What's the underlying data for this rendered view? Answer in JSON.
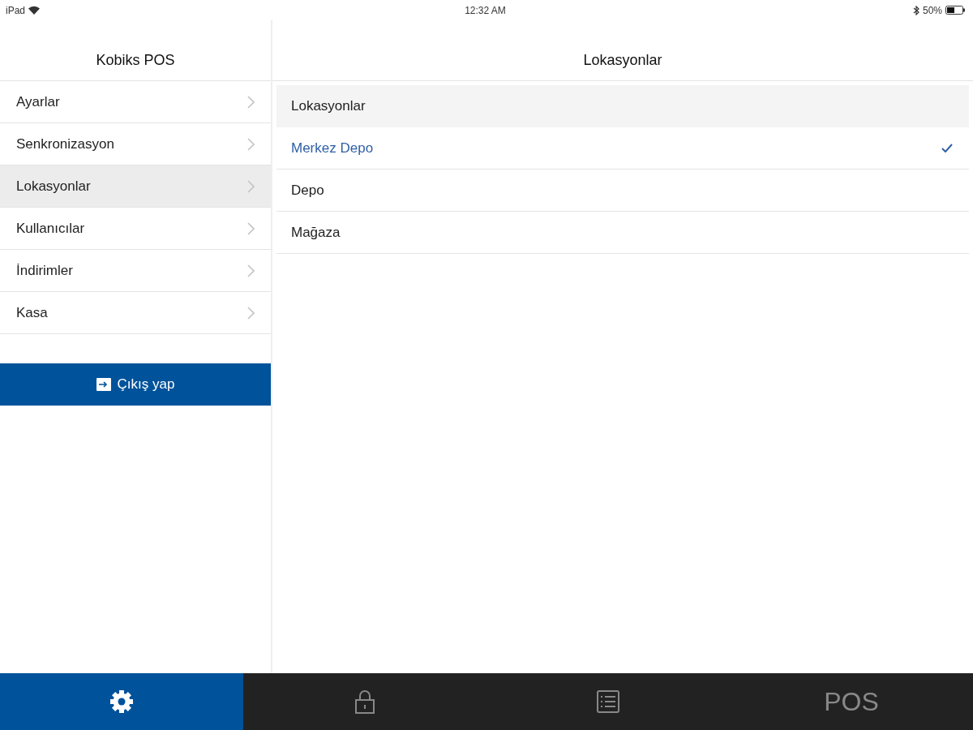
{
  "status_bar": {
    "carrier": "iPad",
    "time": "12:32 AM",
    "battery": "50%"
  },
  "sidebar": {
    "title": "Kobiks POS",
    "items": [
      {
        "label": "Ayarlar",
        "selected": false
      },
      {
        "label": "Senkronizasyon",
        "selected": false
      },
      {
        "label": "Lokasyonlar",
        "selected": true
      },
      {
        "label": "Kullanıcılar",
        "selected": false
      },
      {
        "label": "İndirimler",
        "selected": false
      },
      {
        "label": "Kasa",
        "selected": false
      }
    ],
    "logout_button": "Çıkış yap"
  },
  "detail": {
    "title": "Lokasyonlar",
    "section_header": "Lokasyonlar",
    "items": [
      {
        "label": "Merkez Depo",
        "selected": true
      },
      {
        "label": "Depo",
        "selected": false
      },
      {
        "label": "Mağaza",
        "selected": false
      }
    ]
  },
  "tab_bar": {
    "tabs": [
      {
        "kind": "gear",
        "selected": true
      },
      {
        "kind": "lock",
        "selected": false
      },
      {
        "kind": "list",
        "selected": false
      },
      {
        "kind": "text",
        "label": "POS",
        "selected": false
      }
    ]
  }
}
